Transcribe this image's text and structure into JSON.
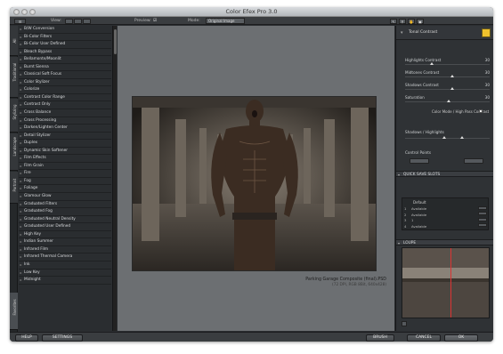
{
  "window": {
    "title": "Color Efex Pro 3.0"
  },
  "toolbar": {
    "view_label": "View:",
    "preview_label": "Preview:",
    "mode_label": "Mode:",
    "mode_value": "Original Image"
  },
  "sidetabs": [
    {
      "label": "All"
    },
    {
      "label": "Traditional"
    },
    {
      "label": "Stylizing"
    },
    {
      "label": "Landscape"
    },
    {
      "label": "Portrait"
    },
    {
      "label": "Favorites"
    }
  ],
  "filters": [
    "B/W Conversion",
    "Bi-Color Filters",
    "Bi-Color User Defined",
    "Bleach Bypass",
    "Bellamonte/Moonlit",
    "Burnt Sienna",
    "Classical Soft Focus",
    "Color Stylizer",
    "Colorize",
    "Contrast Color Range",
    "Contrast Only",
    "Cross Balance",
    "Cross Processing",
    "Darken/Lighten Center",
    "Detail Stylizer",
    "Duplex",
    "Dynamic Skin Softener",
    "Film Effects",
    "Film Grain",
    "Fire",
    "Fog",
    "Foliage",
    "Glamour Glow",
    "Graduated Filters",
    "Graduated Fog",
    "Graduated Neutral Density",
    "Graduated User Defined",
    "High Key",
    "Indian Summer",
    "Infrared Film",
    "Infrared Thermal Camera",
    "Ink",
    "Low Key",
    "Midnight"
  ],
  "preview": {
    "filename": "Parking Garage Composite (final).PSD",
    "info": "(72 DPI, RGB 8Bit, 640x428)"
  },
  "right_panel": {
    "filter_title": "Tonal Contrast",
    "sliders": [
      {
        "label": "Highlights Contrast",
        "value": "30",
        "fraction": 0.3
      },
      {
        "label": "Midtones Contrast",
        "value": "30",
        "fraction": 0.55
      },
      {
        "label": "Shadows Contrast",
        "value": "30",
        "fraction": 0.55
      },
      {
        "label": "Saturation",
        "value": "30",
        "fraction": 0.5
      }
    ],
    "checkbox_label": "Color Mode / High Pass Contrast",
    "shadows_highlights_label": "Shadows / Highlights",
    "control_points_label": "Control Points",
    "quick_save_title": "QUICK SAVE SLOTS",
    "quick_save_default": "Default",
    "quick_save_slots": [
      {
        "num": "1",
        "name": "Available"
      },
      {
        "num": "2",
        "name": "Available"
      },
      {
        "num": "3",
        "name": "1"
      },
      {
        "num": "4",
        "name": "Available"
      }
    ],
    "loupe_title": "LOUPE"
  },
  "bottom": {
    "help": "HELP",
    "settings": "SETTINGS",
    "brush": "BRUSH",
    "cancel": "CANCEL",
    "ok": "OK"
  },
  "colors": {
    "accent": "#f0c22d",
    "panel": "#2b2e31",
    "preview_bg": "#6c6f72"
  }
}
